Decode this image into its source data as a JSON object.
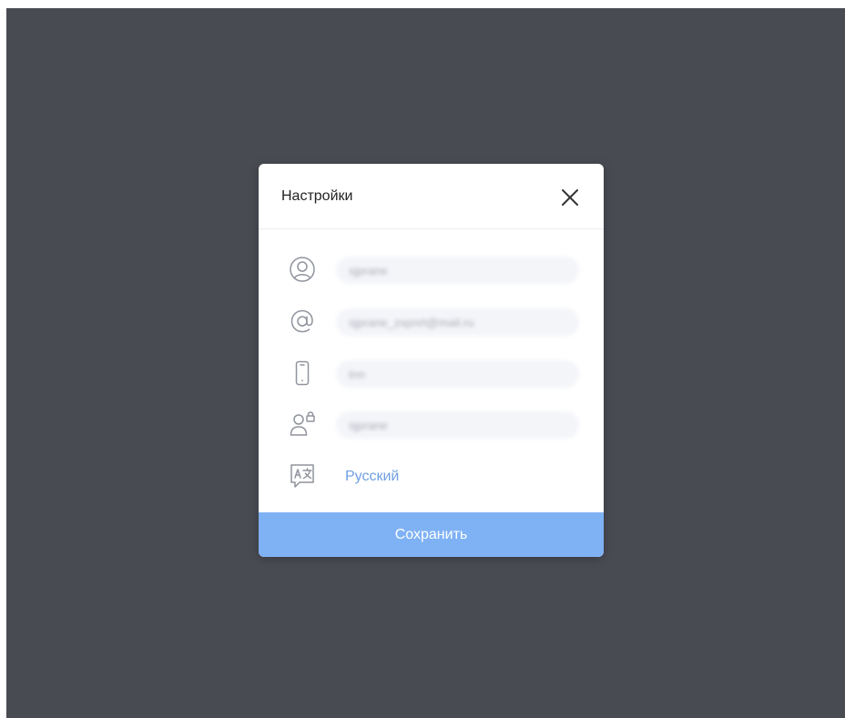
{
  "dialog": {
    "title": "Настройки",
    "close_icon": "close-icon",
    "save_label": "Сохранить"
  },
  "fields": [
    {
      "icon": "user-icon",
      "value": "sjprane"
    },
    {
      "icon": "at-sign-icon",
      "value": "sjprane_zxpnrt@mail.ru"
    },
    {
      "icon": "phone-icon",
      "value": "tnn"
    },
    {
      "icon": "user-lock-icon",
      "value": "sjprane"
    }
  ],
  "language": {
    "icon": "translate-icon",
    "label": "Русский"
  },
  "colors": {
    "backdrop": "#494b53",
    "accent": "#7fb2f5",
    "link": "#6e9fe3",
    "field_bg": "#f4f5f9",
    "icon_stroke": "#8f939c"
  }
}
